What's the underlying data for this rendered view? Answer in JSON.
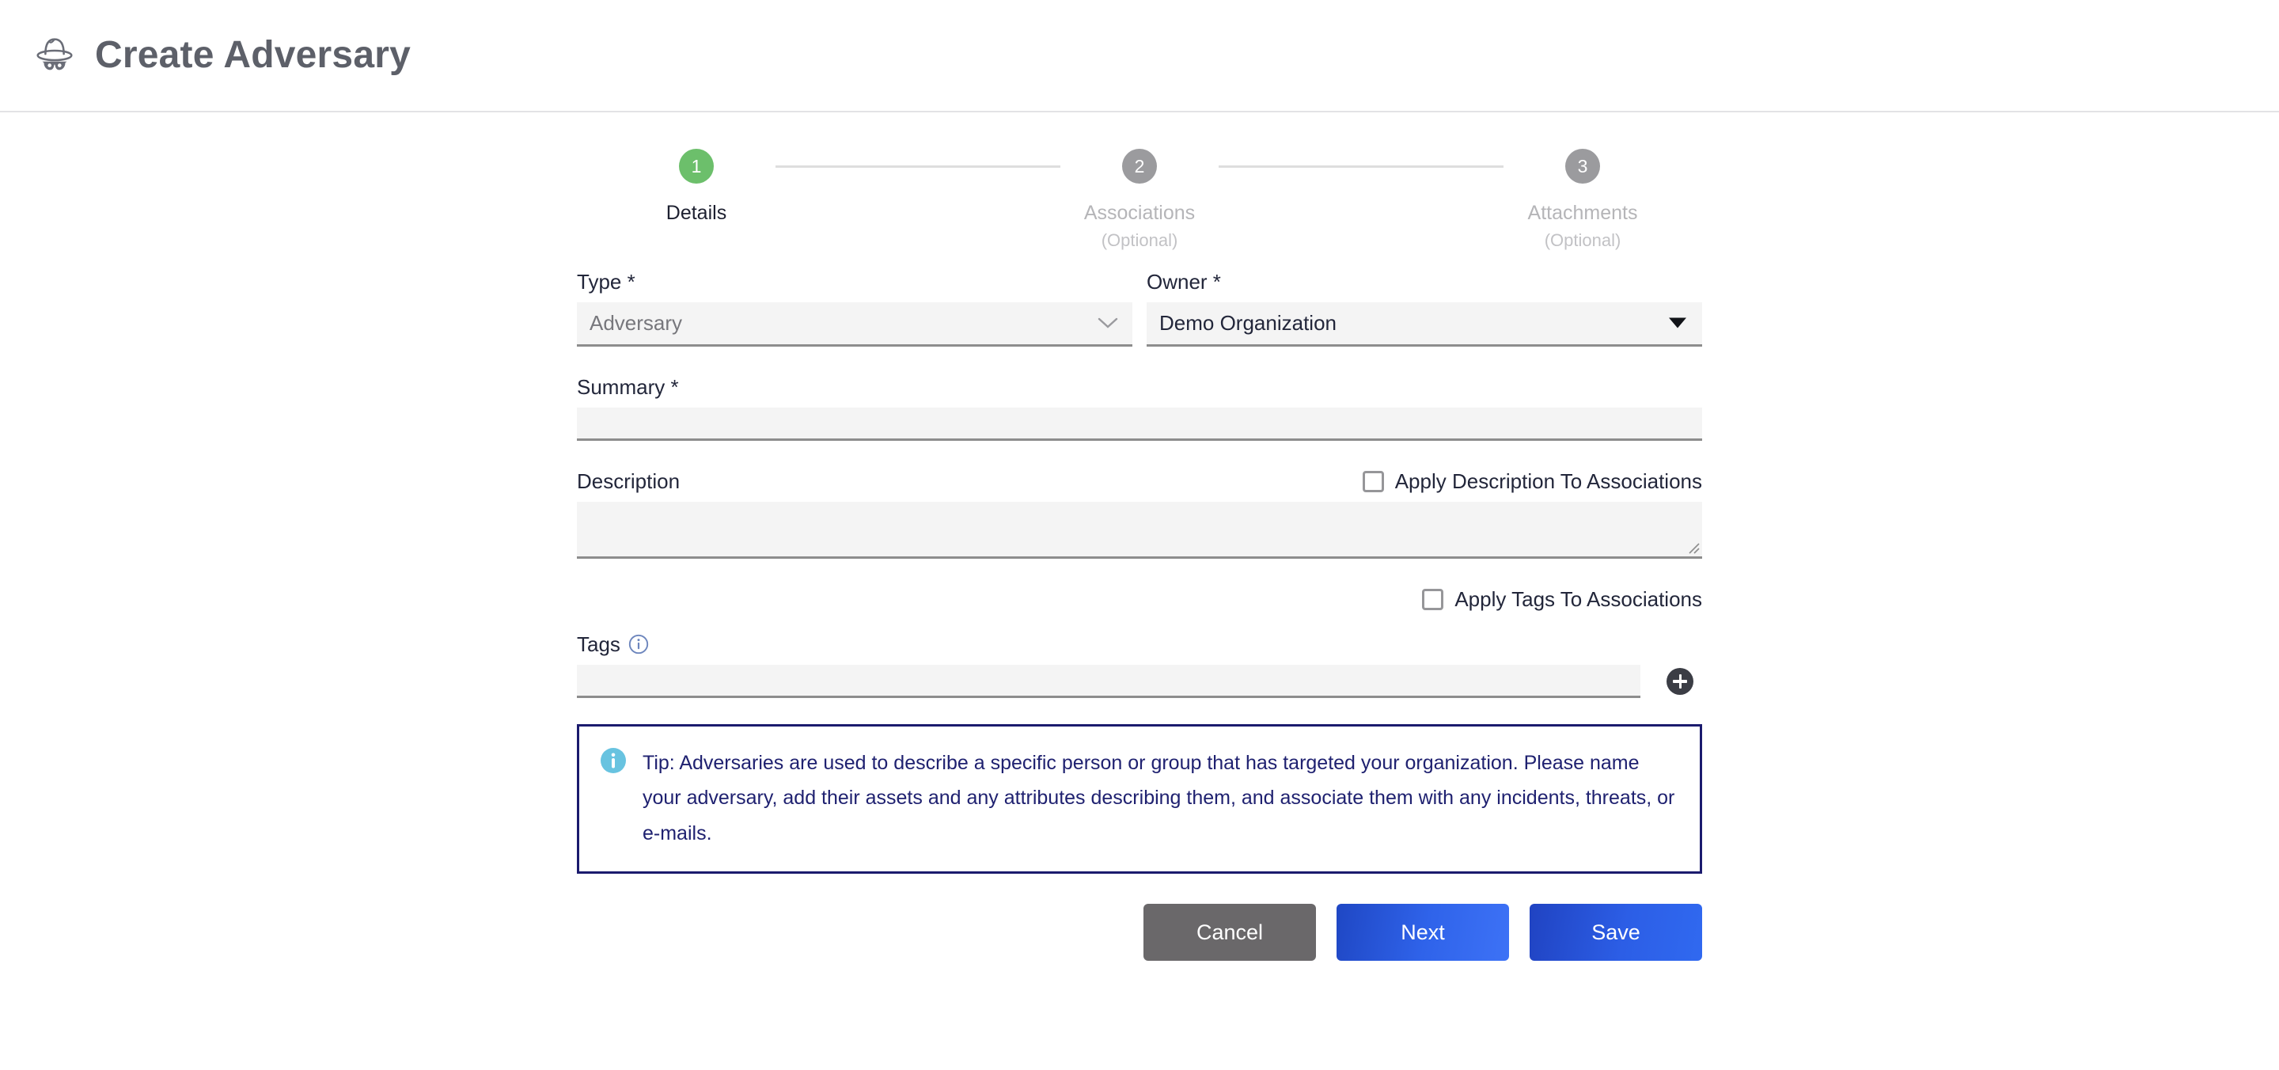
{
  "header": {
    "icon": "spy-incognito-icon",
    "title": "Create Adversary"
  },
  "stepper": {
    "steps": [
      {
        "number": "1",
        "label": "Details",
        "optional": "",
        "state": "active"
      },
      {
        "number": "2",
        "label": "Associations",
        "optional": "(Optional)",
        "state": "inactive"
      },
      {
        "number": "3",
        "label": "Attachments",
        "optional": "(Optional)",
        "state": "inactive"
      }
    ]
  },
  "form": {
    "type": {
      "label": "Type *",
      "value": "Adversary",
      "icon": "chevron-down-icon"
    },
    "owner": {
      "label": "Owner *",
      "value": "Demo Organization",
      "icon": "caret-down-icon"
    },
    "summary": {
      "label": "Summary *",
      "value": "",
      "placeholder": ""
    },
    "description": {
      "label": "Description",
      "value": "",
      "placeholder": "",
      "apply_checkbox_label": "Apply Description To Associations",
      "apply_checkbox_checked": false
    },
    "tags": {
      "label": "Tags",
      "info_icon": "info-icon",
      "value": "",
      "placeholder": "",
      "add_icon": "plus-icon",
      "apply_checkbox_label": "Apply Tags To Associations",
      "apply_checkbox_checked": false
    }
  },
  "tip": {
    "icon": "info-icon",
    "text": "Tip: Adversaries are used to describe a specific person or group that has targeted your organization. Please name your adversary, add their assets and any attributes describing them, and associate them with any incidents, threats, or e-mails."
  },
  "actions": {
    "cancel_label": "Cancel",
    "next_label": "Next",
    "save_label": "Save"
  },
  "colors": {
    "step_active": "#6cbf6b",
    "step_inactive": "#9b9b9e",
    "primary_blue": "#2c5ee6",
    "cancel_gray": "#6a686a",
    "tip_border": "#1b1b6e",
    "tip_text": "#1f2170",
    "field_fill": "#f4f4f4"
  }
}
